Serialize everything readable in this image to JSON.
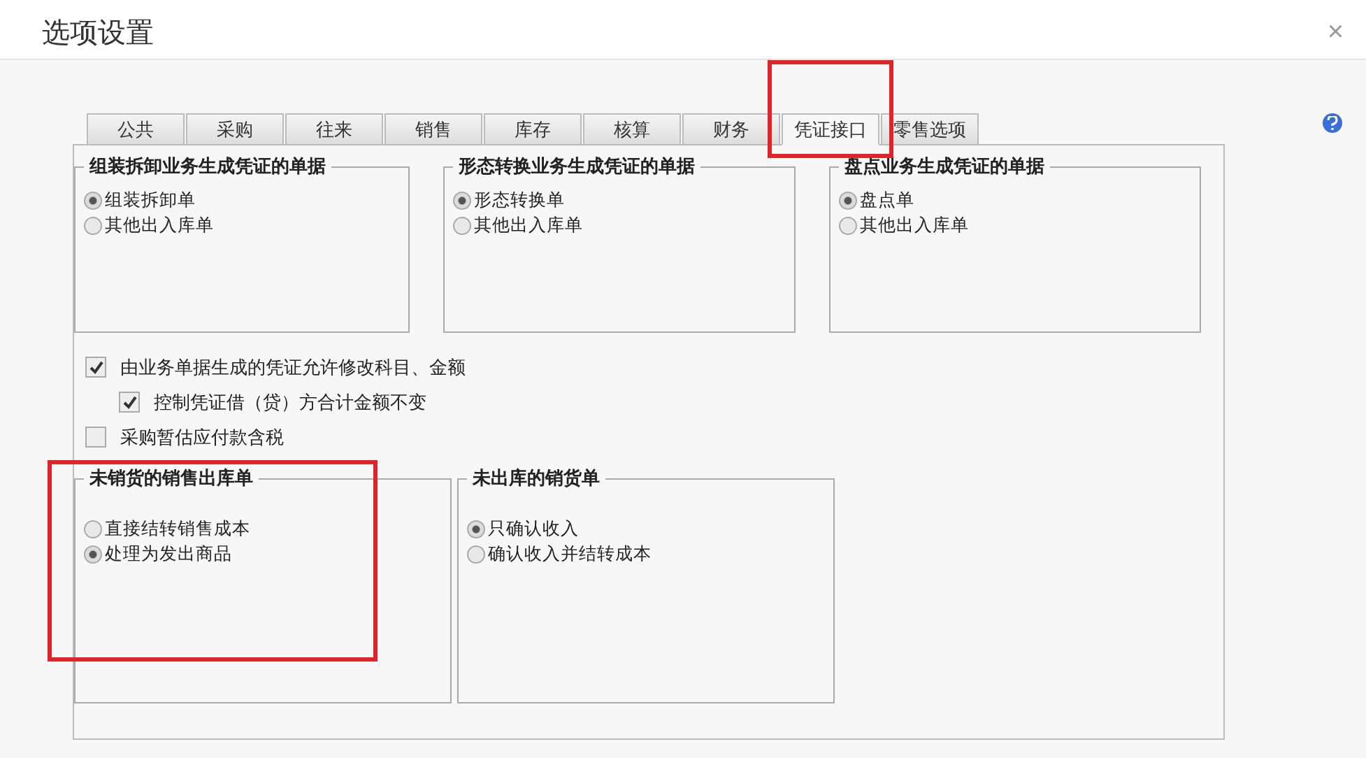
{
  "window": {
    "title": "选项设置",
    "close": "×"
  },
  "tabs": [
    {
      "label": "公共",
      "selected": false,
      "highlighted": false
    },
    {
      "label": "采购",
      "selected": false,
      "highlighted": false
    },
    {
      "label": "往来",
      "selected": false,
      "highlighted": false
    },
    {
      "label": "销售",
      "selected": false,
      "highlighted": false
    },
    {
      "label": "库存",
      "selected": false,
      "highlighted": false
    },
    {
      "label": "核算",
      "selected": false,
      "highlighted": false
    },
    {
      "label": "财务",
      "selected": false,
      "highlighted": false
    },
    {
      "label": "凭证接口",
      "selected": true,
      "highlighted": true
    },
    {
      "label": "零售选项",
      "selected": false,
      "highlighted": false
    }
  ],
  "top_groups": [
    {
      "title": "组装拆卸业务生成凭证的单据",
      "highlighted": false,
      "options": [
        {
          "label": "组装拆卸单",
          "selected": true
        },
        {
          "label": "其他出入库单",
          "selected": false
        }
      ]
    },
    {
      "title": "形态转换业务生成凭证的单据",
      "highlighted": false,
      "options": [
        {
          "label": "形态转换单",
          "selected": true
        },
        {
          "label": "其他出入库单",
          "selected": false
        }
      ]
    },
    {
      "title": "盘点业务生成凭证的单据",
      "highlighted": false,
      "options": [
        {
          "label": "盘点单",
          "selected": true
        },
        {
          "label": "其他出入库单",
          "selected": false
        }
      ]
    }
  ],
  "checkboxes": [
    {
      "label": "由业务单据生成的凭证允许修改科目、金额",
      "checked": true,
      "children": [
        {
          "label": "控制凭证借（贷）方合计金额不变",
          "checked": true
        }
      ]
    },
    {
      "label": "采购暂估应付款含税",
      "checked": false
    }
  ],
  "bottom_groups": [
    {
      "title": "未销货的销售出库单",
      "highlighted": true,
      "options": [
        {
          "label": "直接结转销售成本",
          "selected": false
        },
        {
          "label": "处理为发出商品",
          "selected": true
        }
      ]
    },
    {
      "title": "未出库的销货单",
      "highlighted": false,
      "options": [
        {
          "label": "只确认收入",
          "selected": true
        },
        {
          "label": "确认收入并结转成本",
          "selected": false
        }
      ]
    }
  ]
}
